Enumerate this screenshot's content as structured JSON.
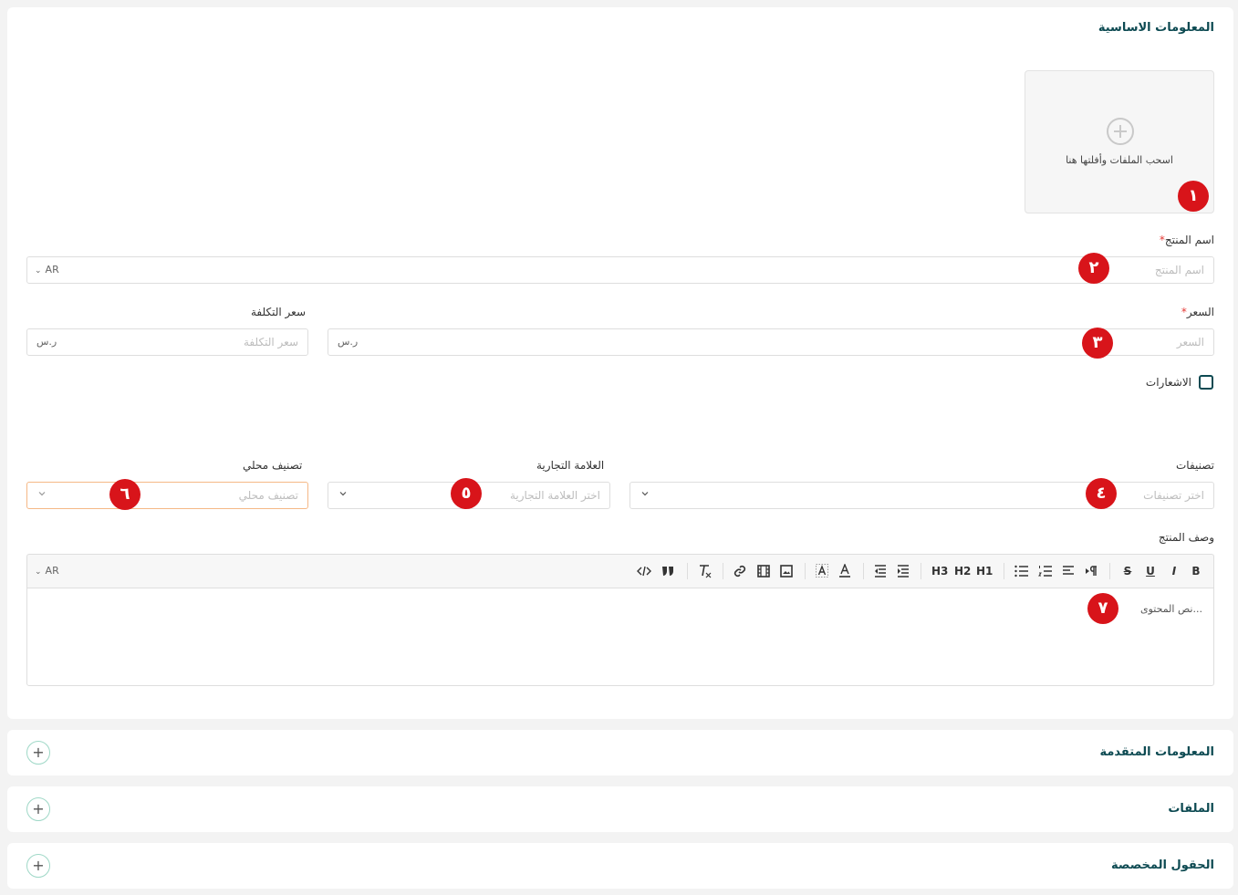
{
  "basic_info": {
    "title": "المعلومات الاساسية",
    "upload": {
      "text": "اسحب الملفات وأفلتها هنا"
    },
    "product_name": {
      "label": "اسم المنتج",
      "required_mark": "*",
      "placeholder": "اسم المنتج",
      "lang": "AR"
    },
    "price": {
      "label": "السعر",
      "required_mark": "*",
      "placeholder": "السعر",
      "currency": "ر.س"
    },
    "cost_price": {
      "label": "سعر التكلفة",
      "placeholder": "سعر التكلفة",
      "currency": "ر.س"
    },
    "notifications": {
      "label": "الاشعارات",
      "checked": false
    },
    "categories": {
      "label": "تصنيفات",
      "placeholder": "اختر تصنيفات"
    },
    "brand": {
      "label": "العلامة التجارية",
      "placeholder": "اختر العلامة التجارية"
    },
    "local_category": {
      "label": "تصنيف محلي",
      "placeholder": "تصنيف محلي"
    },
    "description": {
      "label": "وصف المنتج",
      "lang": "AR",
      "placeholder": "...نص المحتوى",
      "toolbar": {
        "bold": "B",
        "italic": "I",
        "underline": "U",
        "strike": "S",
        "h1": "H1",
        "h2": "H2",
        "h3": "H3"
      }
    }
  },
  "badges": [
    "١",
    "٢",
    "٣",
    "٤",
    "٥",
    "٦",
    "٧"
  ],
  "sections": [
    {
      "title": "المعلومات المتقدمة"
    },
    {
      "title": "الملفات"
    },
    {
      "title": "الحقول المخصصة"
    }
  ],
  "colors": {
    "accent": "#0d4a52",
    "badge": "#d8141a",
    "required": "#e53935",
    "focus_border": "#f5b886"
  }
}
